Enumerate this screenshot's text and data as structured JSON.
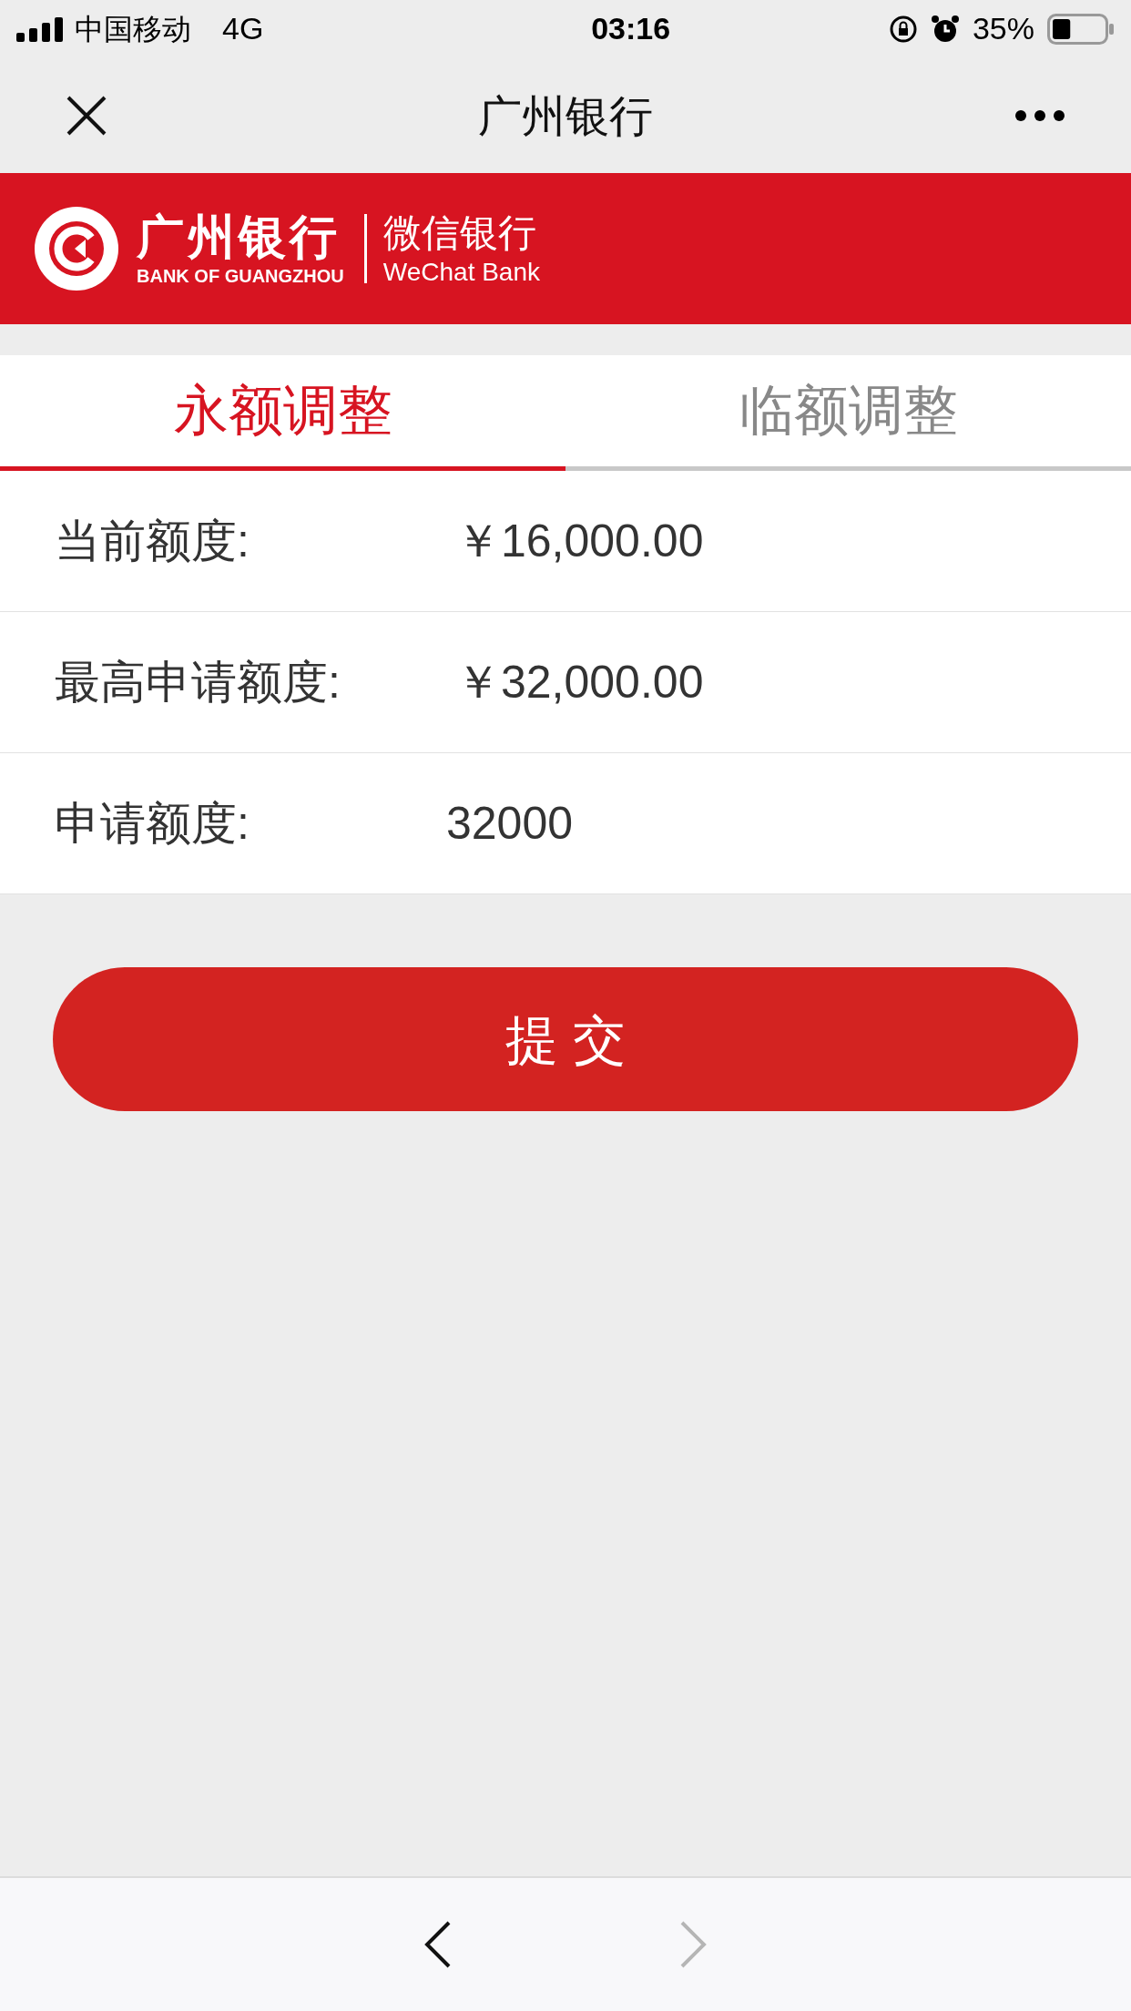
{
  "status_bar": {
    "carrier": "中国移动",
    "network": "4G",
    "time": "03:16",
    "battery": "35%"
  },
  "nav_bar": {
    "title": "广州银行"
  },
  "banner": {
    "bank_name": "广州银行",
    "bank_name_en": "BANK OF GUANGZHOU",
    "service_name": "微信银行",
    "service_name_en": "WeChat Bank"
  },
  "tabs": [
    {
      "label": "永额调整",
      "selected": true
    },
    {
      "label": "临额调整",
      "selected": false
    }
  ],
  "rows": [
    {
      "kind": "display",
      "label": "当前额度:",
      "value": "￥16,000.00"
    },
    {
      "kind": "display",
      "label": "最高申请额度:",
      "value": "￥32,000.00"
    },
    {
      "kind": "input",
      "label": "申请额度:",
      "value": "32000"
    }
  ],
  "submit_button": "提 交",
  "browser_nav": {
    "back_disabled": false,
    "forward_disabled": true
  }
}
